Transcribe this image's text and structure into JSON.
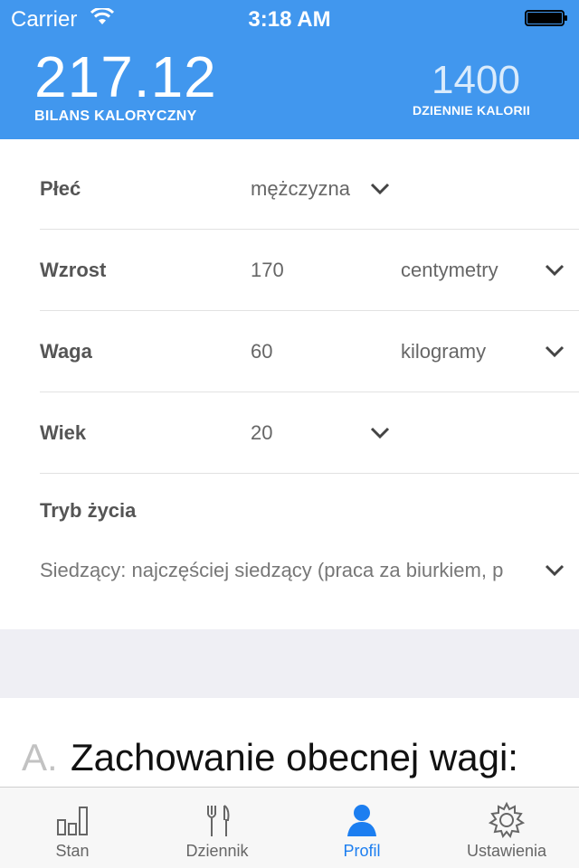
{
  "status_bar": {
    "carrier": "Carrier",
    "time": "3:18 AM"
  },
  "summary": {
    "balance_value": "217.12",
    "balance_label": "BILANS KALORYCZNY",
    "daily_value": "1400",
    "daily_label": "DZIENNIE KALORII"
  },
  "form": {
    "gender": {
      "label": "Płeć",
      "value": "mężczyzna"
    },
    "height": {
      "label": "Wzrost",
      "value": "170",
      "unit": "centymetry"
    },
    "weight": {
      "label": "Waga",
      "value": "60",
      "unit": "kilogramy"
    },
    "age": {
      "label": "Wiek",
      "value": "20"
    },
    "lifestyle": {
      "label": "Tryb życia",
      "value": "Siedzący: najczęściej siedzący (praca za biurkiem, p"
    }
  },
  "plan": {
    "letter": "A.",
    "title": "Zachowanie obecnej wagi:"
  },
  "tabs": [
    {
      "label": "Stan",
      "icon": "bar-chart-icon",
      "active": false
    },
    {
      "label": "Dziennik",
      "icon": "fork-knife-icon",
      "active": false
    },
    {
      "label": "Profil",
      "icon": "user-icon",
      "active": true
    },
    {
      "label": "Ustawienia",
      "icon": "gear-icon",
      "active": false
    }
  ],
  "colors": {
    "accent": "#4197ee",
    "tab_active": "#1c7ef0",
    "background_band": "#efeff4"
  }
}
